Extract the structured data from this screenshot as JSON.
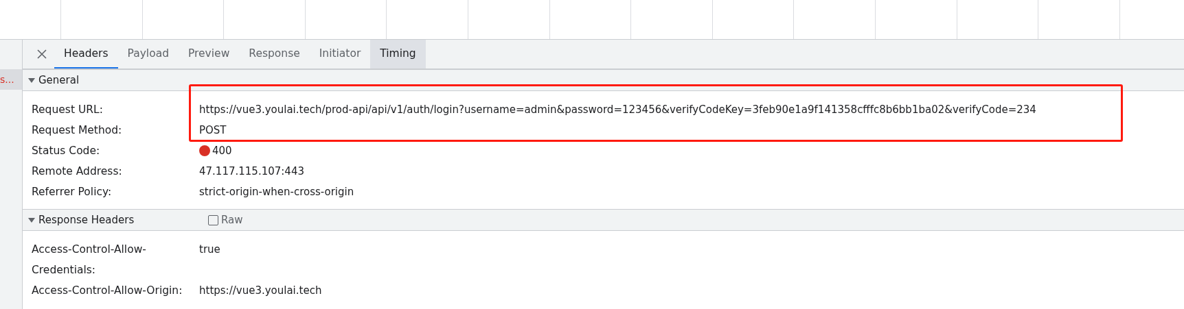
{
  "request_list": {
    "items": [
      {
        "name": "s...",
        "error": true,
        "selected": true
      }
    ]
  },
  "tabs": [
    {
      "label": "Headers",
      "selected": true,
      "hovered": false
    },
    {
      "label": "Payload",
      "selected": false,
      "hovered": false
    },
    {
      "label": "Preview",
      "selected": false,
      "hovered": false
    },
    {
      "label": "Response",
      "selected": false,
      "hovered": false
    },
    {
      "label": "Initiator",
      "selected": false,
      "hovered": false
    },
    {
      "label": "Timing",
      "selected": false,
      "hovered": true
    }
  ],
  "sections": [
    {
      "title": "General",
      "expanded": true,
      "rows": [
        {
          "name": "Request URL:",
          "value": "https://vue3.youlai.tech/prod-api/api/v1/auth/login?username=admin&password=123456&verifyCodeKey=3feb90e1a9f141358cfffc8b6bb1ba02&verifyCode=234"
        },
        {
          "name": "Request Method:",
          "value": "POST"
        },
        {
          "name": "Status Code:",
          "value": "400",
          "color": "#d93025"
        },
        {
          "name": "Remote Address:",
          "value": "47.117.115.107:443"
        },
        {
          "name": "Referrer Policy:",
          "value": "strict-origin-when-cross-origin"
        }
      ]
    },
    {
      "title": "Response Headers",
      "expanded": true,
      "raw": {
        "label": "Raw",
        "checked": false
      },
      "rows": [
        {
          "name": "Access-Control-Allow-Credentials:",
          "value": "true"
        },
        {
          "name": "Access-Control-Allow-Origin:",
          "value": "https://vue3.youlai.tech"
        }
      ]
    }
  ]
}
